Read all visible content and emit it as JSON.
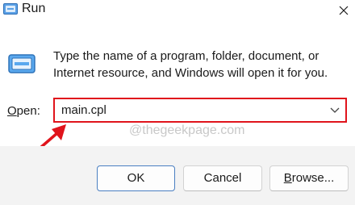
{
  "window": {
    "title": "Run",
    "title_icon": "run-dialog-icon",
    "close_icon": "close-icon"
  },
  "content": {
    "icon": "run-program-icon",
    "description": "Type the name of a program, folder, document, or Internet resource, and Windows will open it for you.",
    "open_label_accel": "O",
    "open_label_rest": "pen:",
    "open_value": "main.cpl",
    "dropdown_icon": "chevron-down-icon",
    "watermark": "@thegeekpage.com",
    "annotation_arrow_color": "#e0141c",
    "highlight_color": "#e0141c"
  },
  "buttons": {
    "ok_label": "OK",
    "cancel_label": "Cancel",
    "browse_accel": "B",
    "browse_rest": "rowse..."
  }
}
